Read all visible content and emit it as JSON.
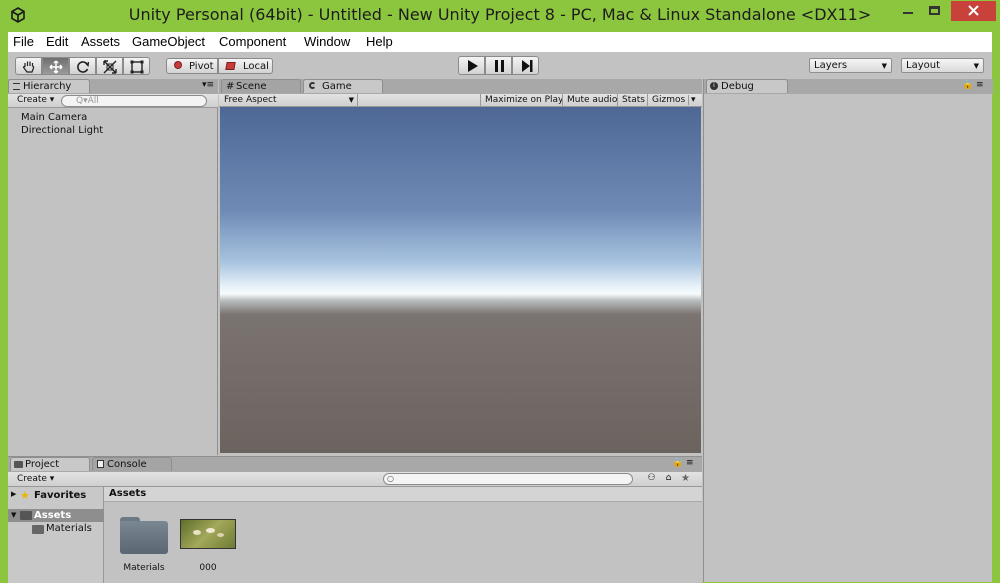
{
  "window": {
    "title": "Unity Personal (64bit) - Untitled - New Unity Project 8 - PC, Mac & Linux Standalone <DX11>",
    "controls": {
      "minimize": "—",
      "maximize": "☐",
      "close": "✕"
    }
  },
  "menubar": [
    "File",
    "Edit",
    "Assets",
    "GameObject",
    "Component",
    "Window",
    "Help"
  ],
  "toolbar": {
    "pivot_label": "Pivot",
    "local_label": "Local",
    "layers_label": "Layers",
    "layout_label": "Layout"
  },
  "hierarchy": {
    "tab_label": "Hierarchy",
    "create_label": "Create",
    "search_placeholder": "Q▾All",
    "items": [
      "Main Camera",
      "Directional Light"
    ]
  },
  "scene_tab_label": "Scene",
  "game": {
    "tab_label": "Game",
    "aspect_label": "Free Aspect",
    "maximize_label": "Maximize on Play",
    "mute_label": "Mute audio",
    "stats_label": "Stats",
    "gizmos_label": "Gizmos"
  },
  "debug": {
    "tab_label": "Debug"
  },
  "project": {
    "tab_label": "Project",
    "console_tab_label": "Console",
    "create_label": "Create",
    "favorites_label": "Favorites",
    "assets_label": "Assets",
    "materials_label": "Materials",
    "breadcrumb": "Assets",
    "assets": [
      "Materials",
      "000"
    ]
  },
  "colors": {
    "frame": "#8cc63f",
    "panel_bg": "#c2c2c2",
    "sky_top": "#4e6795",
    "horizon": "#f1f7fb",
    "ground": "#6b635e",
    "close_button": "#c8413b"
  }
}
